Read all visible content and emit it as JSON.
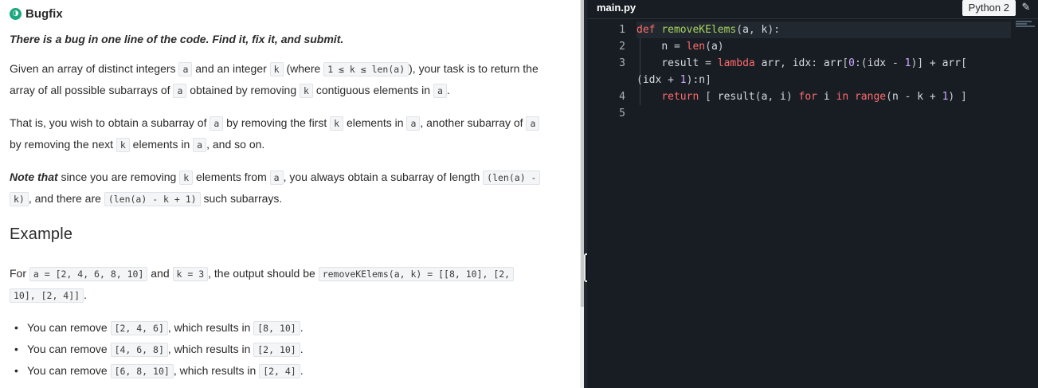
{
  "problem": {
    "logo_glyph": "◑",
    "title": "Bugfix",
    "intro": "There is a bug in one line of the code. Find it, fix it, and submit.",
    "p1": {
      "t1": "Given an array of distinct integers ",
      "c1": "a",
      "t2": " and an integer ",
      "c2": "k",
      "t3": " (where ",
      "c3": "1 ≤ k ≤ len(a)",
      "t4": "), your task is to return the",
      "t5": "array of all possible subarrays of ",
      "c4": "a",
      "t6": " obtained by removing ",
      "c5": "k",
      "t7": " contiguous elements in ",
      "c6": "a",
      "t8": "."
    },
    "p2": {
      "t1": "That is, you wish to obtain a subarray of ",
      "c1": "a",
      "t2": " by removing the first ",
      "c2": "k",
      "t3": " elements in ",
      "c3": "a",
      "t4": ", another subarray of ",
      "c4": "a",
      "t5": "by removing the next ",
      "c5": "k",
      "t6": " elements in ",
      "c6": "a",
      "t7": ", and so on."
    },
    "p3": {
      "note": "Note that",
      "t1": " since you are removing ",
      "c1": "k",
      "t2": " elements from ",
      "c2": "a",
      "t3": ", you always obtain a subarray of length ",
      "c3a": "(len(a) -",
      "c3b": "k)",
      "t4": ", and there are ",
      "c4": "(len(a) - k + 1)",
      "t5": " such subarrays."
    },
    "example_heading": "Example",
    "p4": {
      "t1": "For ",
      "c1": "a = [2, 4, 6, 8, 10]",
      "t2": " and ",
      "c2": "k = 3",
      "t3": ", the output should be ",
      "c3a": "removeKElems(a, k) = [[8, 10], [2,",
      "c3b": "10], [2, 4]]",
      "t4": "."
    },
    "bullets": [
      {
        "t1": "You can remove ",
        "c1": "[2, 4, 6]",
        "t2": ", which results in ",
        "c2": "[8, 10]",
        "t3": "."
      },
      {
        "t1": "You can remove ",
        "c1": "[4, 6, 8]",
        "t2": ", which results in ",
        "c2": "[2, 10]",
        "t3": "."
      },
      {
        "t1": "You can remove ",
        "c1": "[6, 8, 10]",
        "t2": ", which results in ",
        "c2": "[2, 4]",
        "t3": "."
      }
    ]
  },
  "editor": {
    "filename": "main.py",
    "language": "Python 2",
    "edit_icon": "pencil-icon",
    "line_numbers": [
      "1",
      "2",
      "3",
      "",
      "4",
      "5"
    ],
    "lines": [
      [
        [
          "kw",
          "def "
        ],
        [
          "fn",
          "removeKElems"
        ],
        [
          "op",
          "("
        ],
        [
          "var",
          "a"
        ],
        [
          "op",
          ", "
        ],
        [
          "var",
          "k"
        ],
        [
          "op",
          "):"
        ]
      ],
      [
        [
          "op",
          "    "
        ],
        [
          "var",
          "n"
        ],
        [
          "op",
          " = "
        ],
        [
          "bi",
          "len"
        ],
        [
          "op",
          "("
        ],
        [
          "var",
          "a"
        ],
        [
          "op",
          ")"
        ]
      ],
      [
        [
          "op",
          "    "
        ],
        [
          "var",
          "result"
        ],
        [
          "op",
          " = "
        ],
        [
          "kw",
          "lambda"
        ],
        [
          "op",
          " "
        ],
        [
          "var",
          "arr"
        ],
        [
          "op",
          ", "
        ],
        [
          "var",
          "idx"
        ],
        [
          "op",
          ": "
        ],
        [
          "var",
          "arr"
        ],
        [
          "op",
          "["
        ],
        [
          "num",
          "0"
        ],
        [
          "op",
          ":("
        ],
        [
          "var",
          "idx"
        ],
        [
          "op",
          " - "
        ],
        [
          "num",
          "1"
        ],
        [
          "op",
          ")] + "
        ],
        [
          "var",
          "arr"
        ],
        [
          "op",
          "["
        ]
      ],
      [
        [
          "op",
          "("
        ],
        [
          "var",
          "idx"
        ],
        [
          "op",
          " + "
        ],
        [
          "num",
          "1"
        ],
        [
          "op",
          "):"
        ],
        [
          "var",
          "n"
        ],
        [
          "op",
          "]"
        ]
      ],
      [
        [
          "op",
          "    "
        ],
        [
          "kw",
          "return"
        ],
        [
          "op",
          " [ "
        ],
        [
          "var",
          "result"
        ],
        [
          "op",
          "("
        ],
        [
          "var",
          "a"
        ],
        [
          "op",
          ", "
        ],
        [
          "var",
          "i"
        ],
        [
          "op",
          ") "
        ],
        [
          "kw",
          "for"
        ],
        [
          "op",
          " "
        ],
        [
          "var",
          "i"
        ],
        [
          "op",
          " "
        ],
        [
          "kw",
          "in"
        ],
        [
          "op",
          " "
        ],
        [
          "bi",
          "range"
        ],
        [
          "op",
          "("
        ],
        [
          "var",
          "n"
        ],
        [
          "op",
          " - "
        ],
        [
          "var",
          "k"
        ],
        [
          "op",
          " + "
        ],
        [
          "num",
          "1"
        ],
        [
          "op",
          ") ]"
        ]
      ],
      []
    ]
  }
}
